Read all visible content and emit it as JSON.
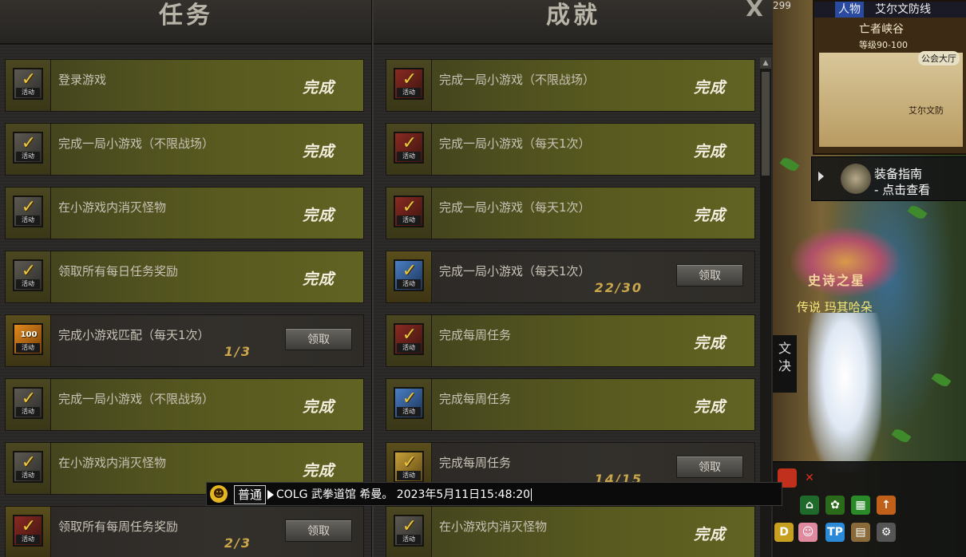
{
  "window": {
    "close_label": "X",
    "left_panel_title": "任务",
    "right_panel_title": "成就",
    "claim_label": "领取",
    "done_label": "完成"
  },
  "tasks": [
    {
      "title": "登录游戏",
      "state": "done",
      "icon": "gray"
    },
    {
      "title": "完成一局小游戏（不限战场）",
      "state": "done",
      "icon": "gray"
    },
    {
      "title": "在小游戏内消灭怪物",
      "state": "done",
      "icon": "gray"
    },
    {
      "title": "领取所有每日任务奖励",
      "state": "done",
      "icon": "gray"
    },
    {
      "title": "完成小游戏匹配（每天1次）",
      "state": "pending",
      "icon": "orange",
      "progress": "1/3",
      "badge": "100"
    },
    {
      "title": "完成一局小游戏（不限战场）",
      "state": "done",
      "icon": "gray"
    },
    {
      "title": "在小游戏内消灭怪物",
      "state": "done",
      "icon": "gray"
    },
    {
      "title": "领取所有每周任务奖励",
      "state": "pending",
      "icon": "red",
      "progress": "2/3"
    }
  ],
  "achievements": [
    {
      "title": "完成一局小游戏（不限战场）",
      "state": "done",
      "icon": "red"
    },
    {
      "title": "完成一局小游戏（每天1次）",
      "state": "done",
      "icon": "red"
    },
    {
      "title": "完成一局小游戏（每天1次）",
      "state": "done",
      "icon": "red"
    },
    {
      "title": "完成一局小游戏（每天1次）",
      "state": "pending",
      "icon": "blue",
      "progress": "22/30"
    },
    {
      "title": "完成每周任务",
      "state": "done",
      "icon": "red"
    },
    {
      "title": "完成每周任务",
      "state": "done",
      "icon": "blue"
    },
    {
      "title": "完成每周任务",
      "state": "pending",
      "icon": "gold",
      "progress": "14/15"
    },
    {
      "title": "在小游戏内消灭怪物",
      "state": "done",
      "icon": "gray"
    }
  ],
  "icon_tag": "活动",
  "world": {
    "coord_text": "299",
    "minimap_tab": "人物",
    "zone_name": "艾尔文防线",
    "area_name": "亡者峡谷",
    "level_range": "等级90-100",
    "guild_hall": "公会大厅",
    "town_label": "艾尔文防",
    "guide_title": "装备指南",
    "guide_sub": "- 点击查看",
    "emblem_text": "史诗之星",
    "character_name": "传说 玛其哈朵",
    "side_tab_text": "文 决"
  },
  "chat": {
    "channel": "普通",
    "input_text": "COLG 武拳道馆 希曼。 2023年5月11日15:48:20"
  },
  "colors": {
    "done_row": "#585a1f",
    "pending_row": "#33302c",
    "progress_text": "#c9a64a"
  }
}
